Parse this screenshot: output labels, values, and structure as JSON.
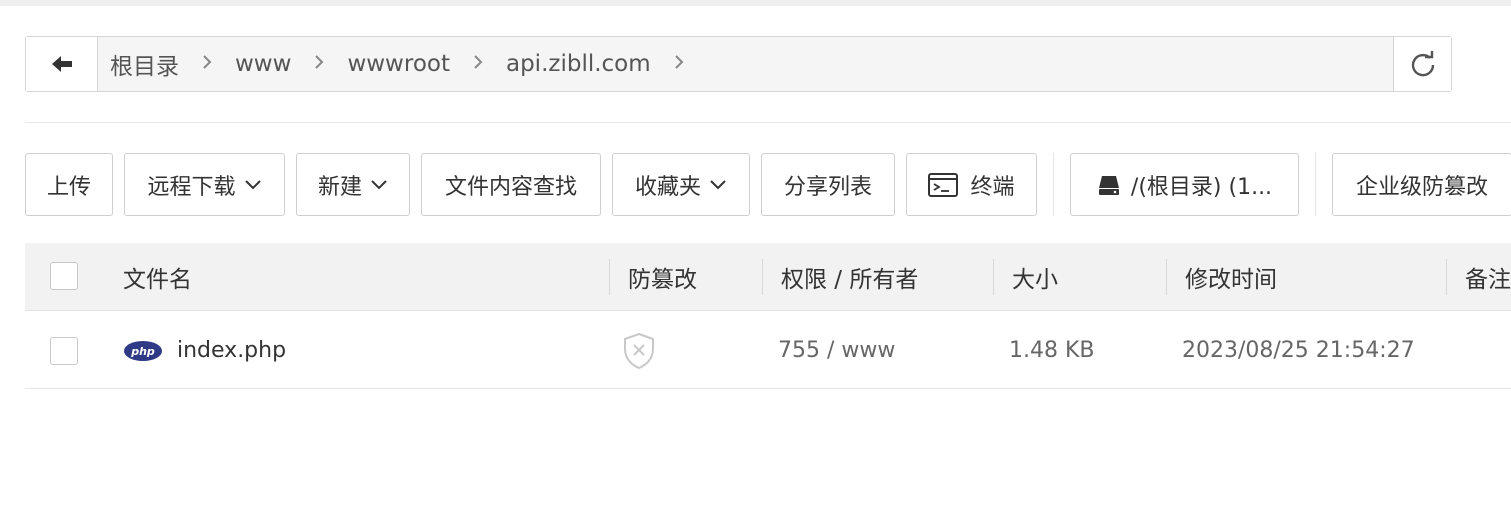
{
  "path": {
    "crumbs": [
      "根目录",
      "www",
      "wwwroot",
      "api.zibll.com"
    ]
  },
  "toolbar": {
    "upload": "上传",
    "remote_download": "远程下载",
    "new": "新建",
    "content_search": "文件内容查找",
    "favorites": "收藏夹",
    "share_list": "分享列表",
    "terminal": "终端",
    "disk": "/(根目录) (1...",
    "enterprise_tamper": "企业级防篡改"
  },
  "table": {
    "headers": {
      "filename": "文件名",
      "tamper": "防篡改",
      "perm_owner": "权限 / 所有者",
      "size": "大小",
      "modified": "修改时间",
      "note": "备注"
    },
    "rows": [
      {
        "icon": "php-icon",
        "icon_text": "php",
        "name": "index.php",
        "perm": "755 / www",
        "size": "1.48 KB",
        "modified": "2023/08/25 21:54:27"
      }
    ]
  },
  "colors": {
    "php_badge": "#2f3a86",
    "header_bg": "#f2f2f2",
    "border": "#d6d6d6"
  }
}
